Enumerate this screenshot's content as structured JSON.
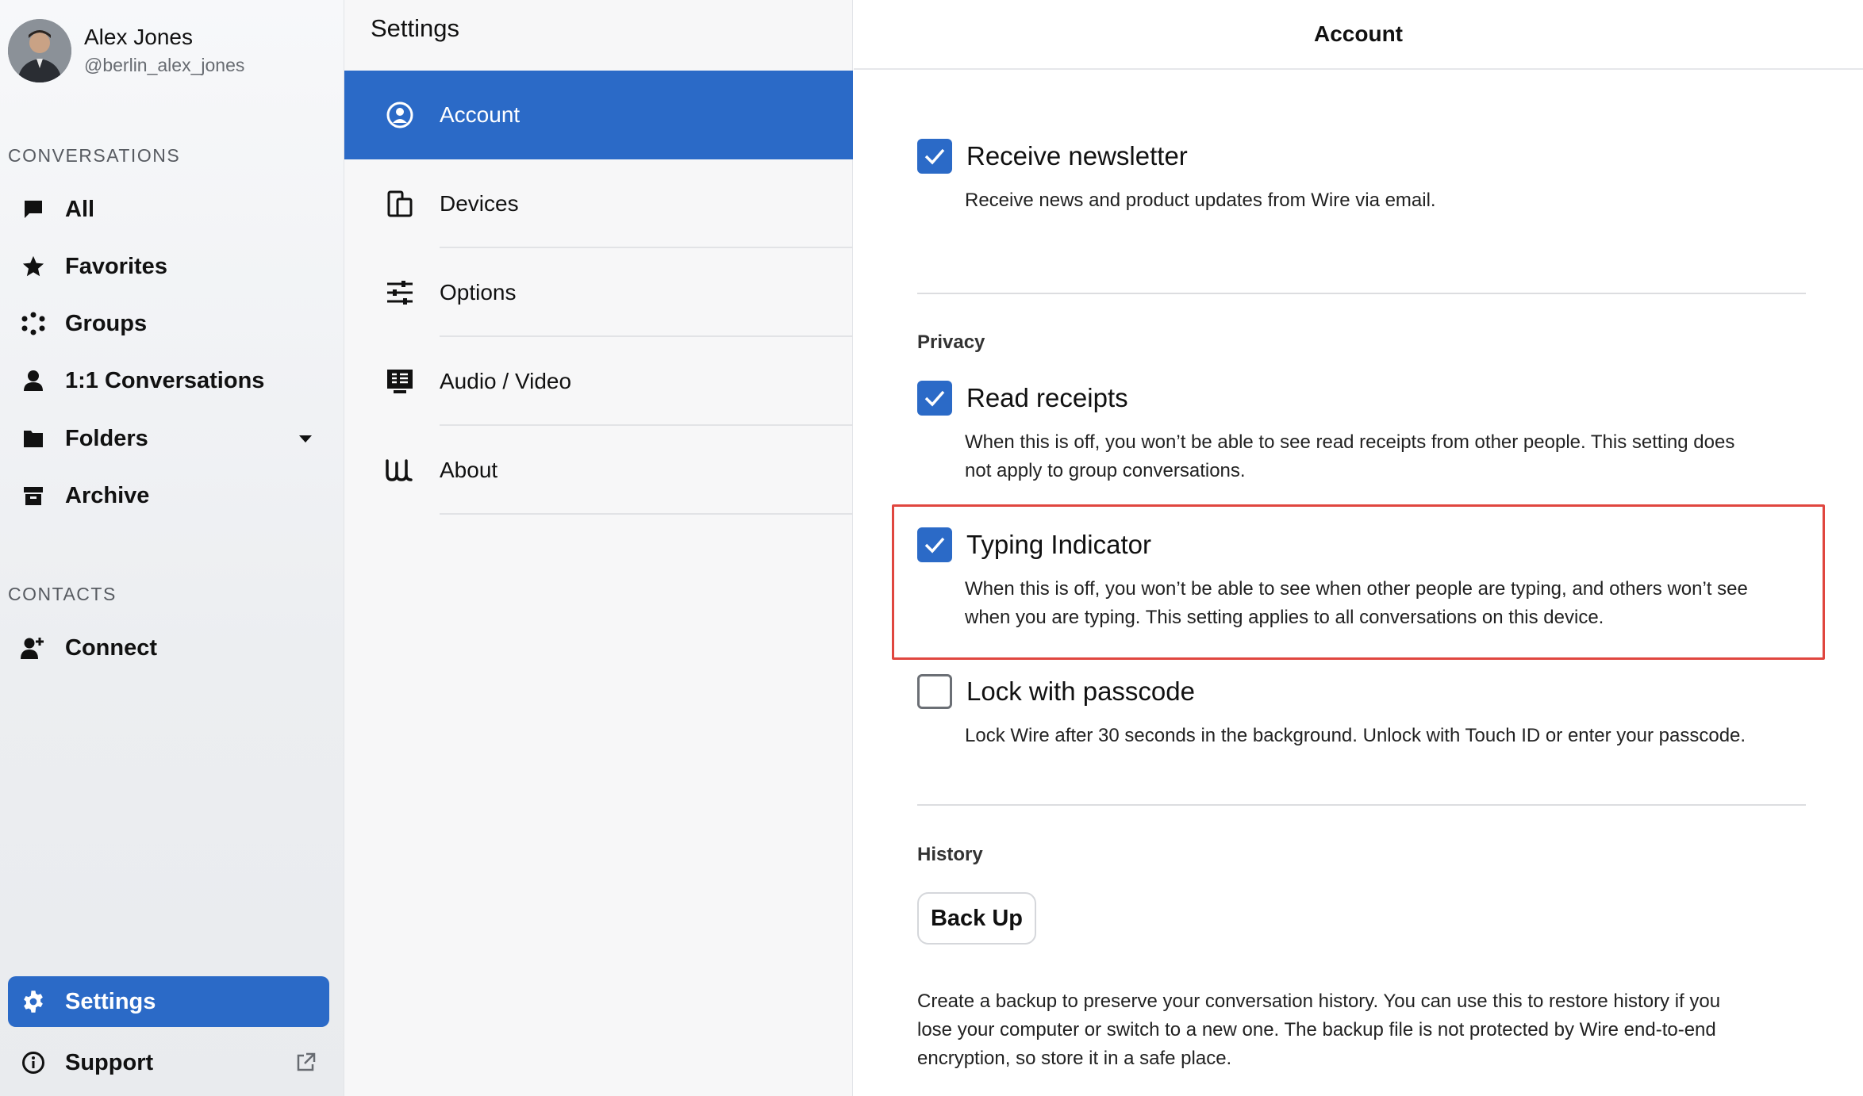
{
  "profile": {
    "name": "Alex Jones",
    "handle": "@berlin_alex_jones"
  },
  "sidebar": {
    "conversations_title": "CONVERSATIONS",
    "items": [
      {
        "label": "All",
        "icon": "chat-bubble-icon"
      },
      {
        "label": "Favorites",
        "icon": "star-icon"
      },
      {
        "label": "Groups",
        "icon": "groups-dots-icon"
      },
      {
        "label": "1:1 Conversations",
        "icon": "person-icon"
      },
      {
        "label": "Folders",
        "icon": "folder-icon"
      },
      {
        "label": "Archive",
        "icon": "archive-box-icon"
      }
    ],
    "contacts_title": "CONTACTS",
    "connect_label": "Connect",
    "settings_label": "Settings",
    "support_label": "Support"
  },
  "settings_menu": {
    "title": "Settings",
    "items": [
      {
        "label": "Account",
        "icon": "account-circle-icon",
        "active": true
      },
      {
        "label": "Devices",
        "icon": "devices-icon",
        "active": false
      },
      {
        "label": "Options",
        "icon": "sliders-icon",
        "active": false
      },
      {
        "label": "Audio / Video",
        "icon": "audio-video-icon",
        "active": false
      },
      {
        "label": "About",
        "icon": "wire-logo-icon",
        "active": false
      }
    ]
  },
  "account": {
    "header": "Account",
    "newsletter": {
      "label": "Receive newsletter",
      "description": "Receive news and product updates from Wire via email.",
      "checked": true
    },
    "privacy_title": "Privacy",
    "read_receipts": {
      "label": "Read receipts",
      "description_line1": "When this is off, you won’t be able to see read receipts from other people. This setting does",
      "description_line2": "not apply to group conversations.",
      "checked": true
    },
    "typing_indicator": {
      "label": "Typing Indicator",
      "description_line1": "When this is off, you won’t be able to see when other people are typing, and others won’t see",
      "description_line2": "when you are typing. This setting applies to all conversations on this device.",
      "checked": true
    },
    "lock_passcode": {
      "label": "Lock with passcode",
      "description": "Lock Wire after 30 seconds in the background. Unlock with Touch ID or enter your passcode.",
      "checked": false
    },
    "history_title": "History",
    "backup_button": "Back Up",
    "history_desc_line1": "Create a backup to preserve your conversation history. You can use this to restore history if you",
    "history_desc_line2": "lose your computer or switch to a new one. The backup file is not protected by Wire end-to-end",
    "history_desc_line3": "encryption, so store it in a safe place."
  },
  "colors": {
    "accent": "#2b6ac7",
    "highlight": "#e0463f"
  }
}
